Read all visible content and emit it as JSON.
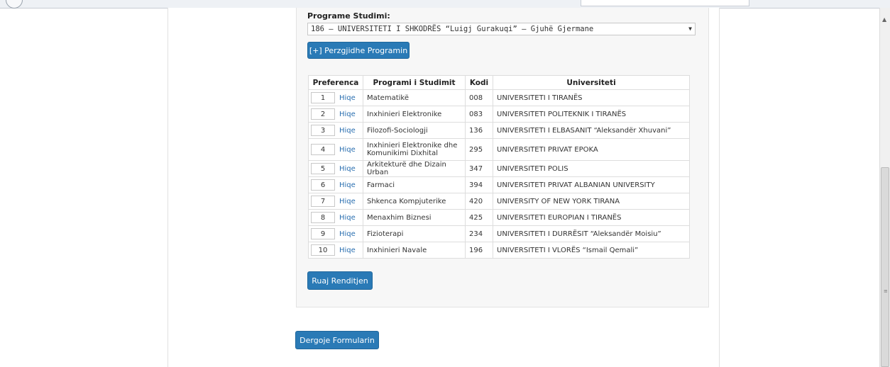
{
  "program": {
    "label": "Programe Studimi:",
    "selected": "186 – UNIVERSITETI I SHKODRËS “Luigj Gurakuqi” – Gjuhë Gjermane",
    "add_button": "[+] Perzgjidhe Programin"
  },
  "table": {
    "headers": {
      "pref": "Preferenca",
      "program": "Programi i Studimit",
      "code": "Kodi",
      "university": "Universiteti"
    },
    "remove_label": "Hiqe",
    "rows": [
      {
        "pref": "1",
        "program": "Matematikë",
        "code": "008",
        "university": "UNIVERSITETI I TIRANËS"
      },
      {
        "pref": "2",
        "program": "Inxhinieri Elektronike",
        "code": "083",
        "university": "UNIVERSITETI POLITEKNIK I TIRANËS"
      },
      {
        "pref": "3",
        "program": "Filozofi-Sociologji",
        "code": "136",
        "university": "UNIVERSITETI I ELBASANIT “Aleksandër Xhuvani”"
      },
      {
        "pref": "4",
        "program": "Inxhinieri Elektronike dhe Komunikimi Dixhital",
        "code": "295",
        "university": "UNIVERSITETI PRIVAT EPOKA"
      },
      {
        "pref": "5",
        "program": "Arkitekturë dhe Dizain Urban",
        "code": "347",
        "university": "UNIVERSITETI POLIS"
      },
      {
        "pref": "6",
        "program": "Farmaci",
        "code": "394",
        "university": "UNIVERSITETI PRIVAT ALBANIAN UNIVERSITY"
      },
      {
        "pref": "7",
        "program": "Shkenca Kompjuterike",
        "code": "420",
        "university": "UNIVERSITY OF NEW YORK TIRANA"
      },
      {
        "pref": "8",
        "program": "Menaxhim Biznesi",
        "code": "425",
        "university": "UNIVERSITETI EUROPIAN I TIRANËS"
      },
      {
        "pref": "9",
        "program": "Fizioterapi",
        "code": "234",
        "university": "UNIVERSITETI I DURRËSIT “Aleksandër Moisiu”"
      },
      {
        "pref": "10",
        "program": "Inxhinieri Navale",
        "code": "196",
        "university": "UNIVERSITETI I VLORËS “Ismail Qemali”"
      }
    ]
  },
  "buttons": {
    "save": "Ruaj Renditjen",
    "send": "Dergoje Formularin"
  },
  "colors": {
    "button": "#2a7ab6",
    "link": "#2a6fb0",
    "panel": "#f7f7f7"
  },
  "icons": {
    "dropdown": "chevron-down-icon",
    "scroll_up": "arrow-up-icon",
    "grip": "grip-icon"
  }
}
